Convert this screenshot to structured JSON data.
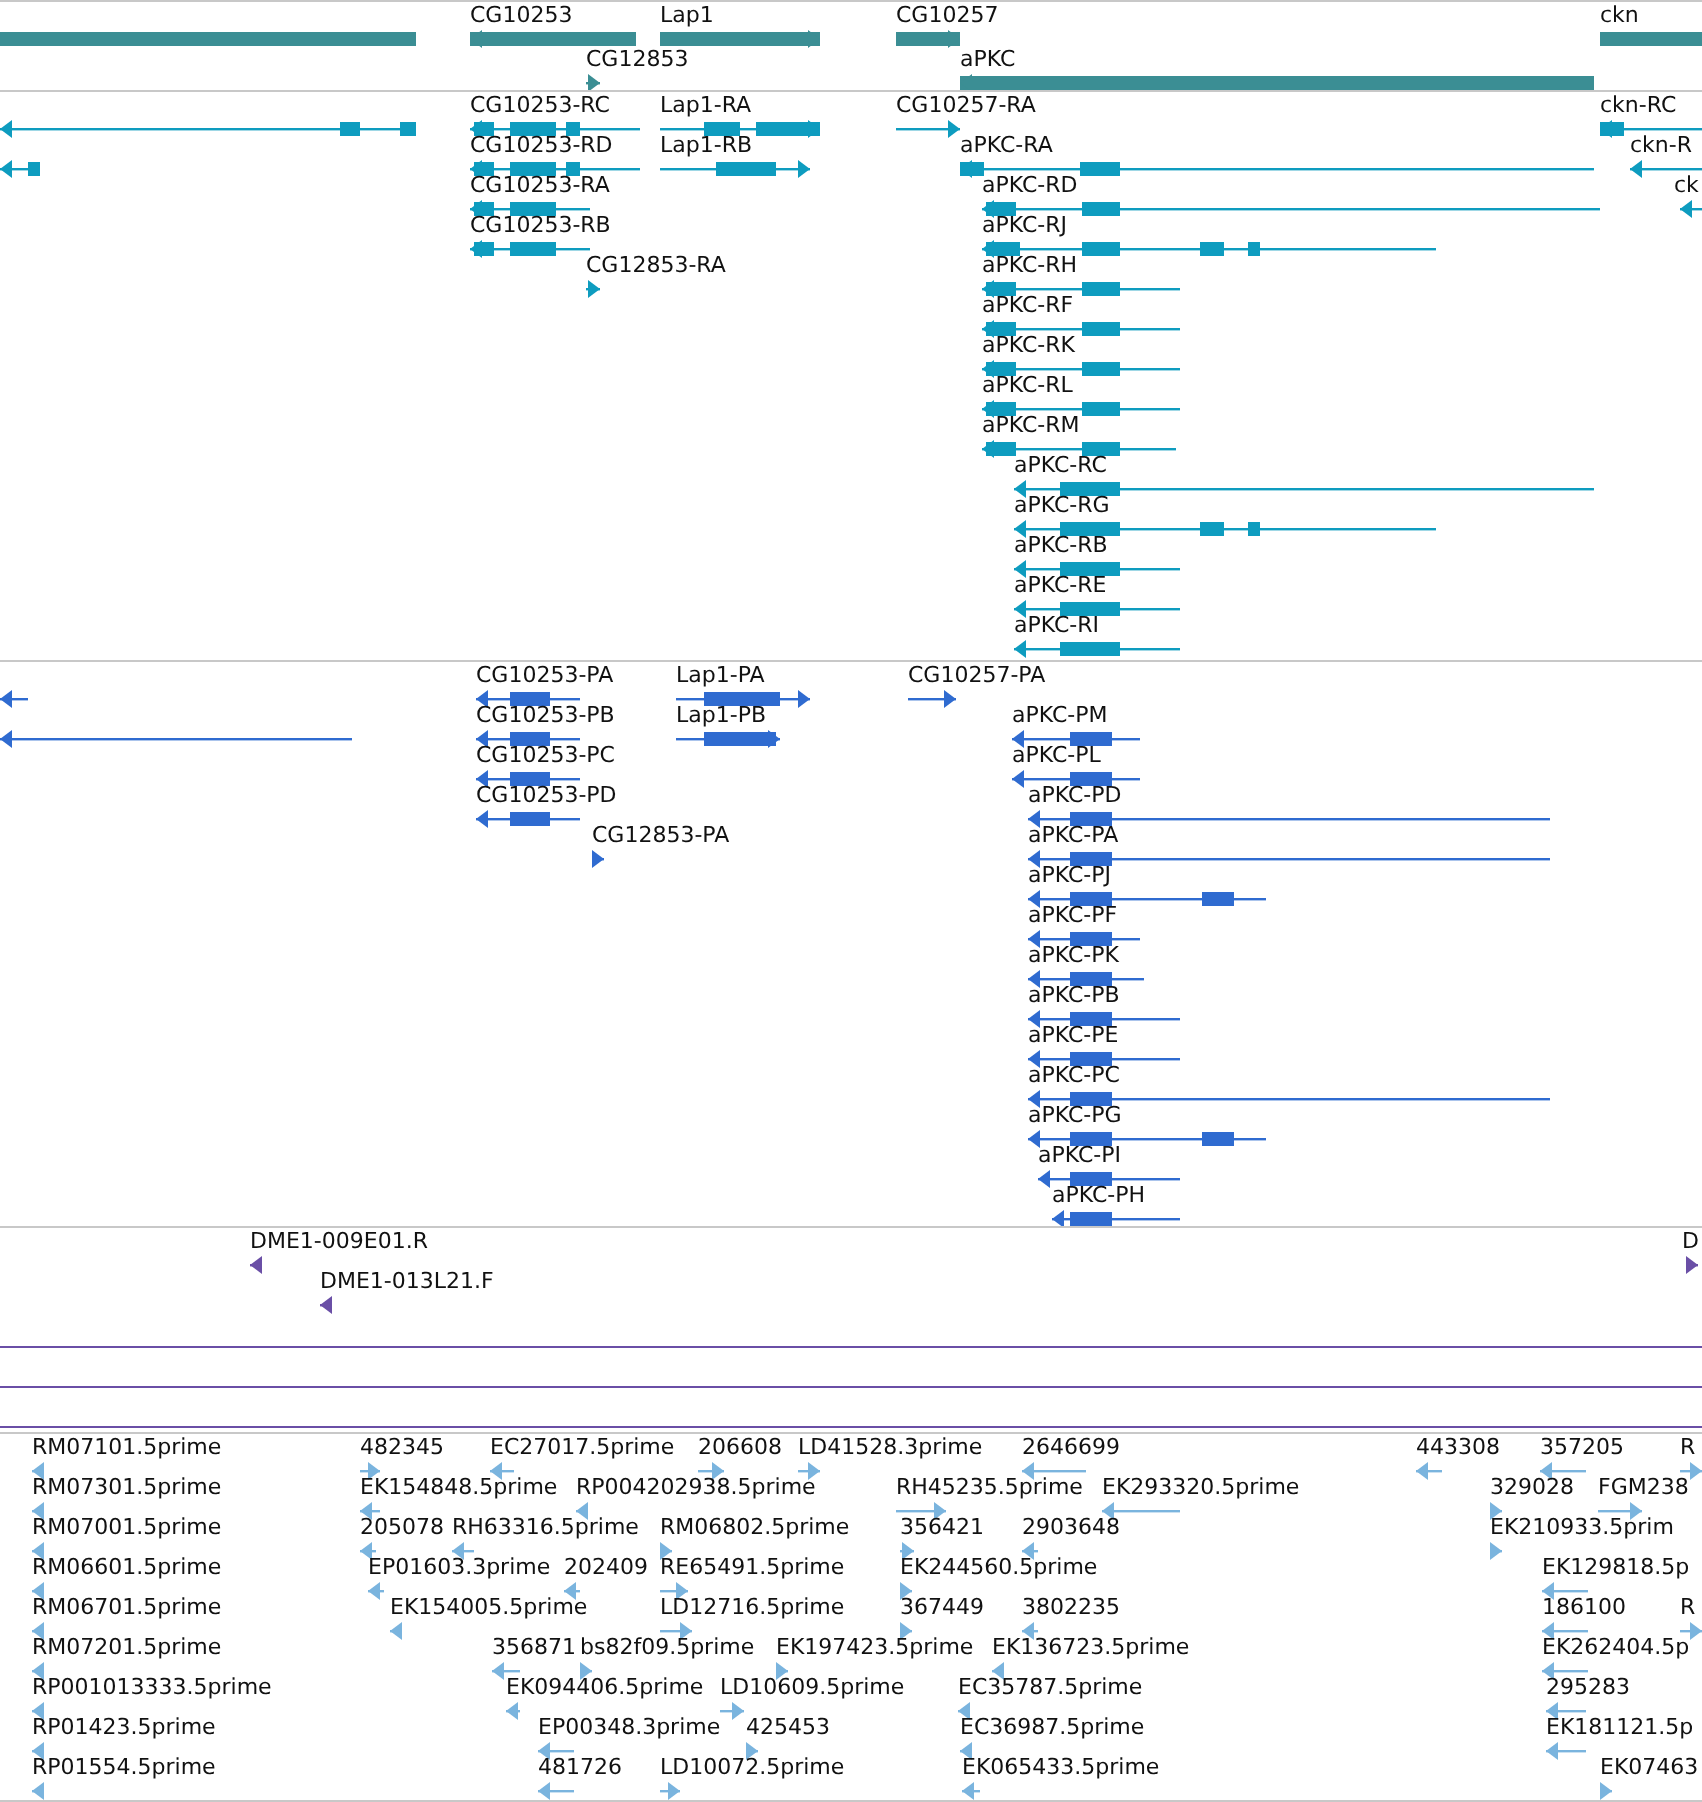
{
  "tracks": [
    {
      "kind": "genes",
      "features": [
        {
          "reverse": true
        },
        {
          "label": "CG10253",
          "reverse": true
        },
        {
          "label": "Lap1",
          "reverse": false
        },
        {
          "label": "CG10257",
          "reverse": false
        },
        {
          "label": "ckn"
        },
        {
          "label": "CG12853",
          "reverse": false
        },
        {
          "label": "aPKC",
          "reverse": true
        }
      ]
    },
    {
      "kind": "transcripts",
      "features": [
        {
          "reverse": true
        },
        {
          "label": "CG10253-RC",
          "reverse": true
        },
        {
          "label": "Lap1-RA",
          "reverse": false
        },
        {
          "label": "CG10257-RA",
          "reverse": false
        },
        {
          "label": "ckn-RC",
          "reverse": true
        },
        {
          "reverse": true
        },
        {
          "label": "CG10253-RD",
          "reverse": true
        },
        {
          "label": "Lap1-RB",
          "reverse": false
        },
        {
          "label": "aPKC-RA",
          "reverse": true
        },
        {
          "label": "ckn-R",
          "reverse": true
        },
        {
          "label": "CG10253-RA",
          "reverse": true
        },
        {
          "label": "aPKC-RD",
          "reverse": true
        },
        {
          "label": "ck",
          "reverse": true
        },
        {
          "label": "CG10253-RB",
          "reverse": true
        },
        {
          "label": "aPKC-RJ",
          "reverse": true
        },
        {
          "label": "CG12853-RA",
          "reverse": false
        },
        {
          "label": "aPKC-RH",
          "reverse": true
        },
        {
          "label": "aPKC-RF",
          "reverse": true
        },
        {
          "label": "aPKC-RK",
          "reverse": true
        },
        {
          "label": "aPKC-RL",
          "reverse": true
        },
        {
          "label": "aPKC-RM",
          "reverse": true
        },
        {
          "label": "aPKC-RC",
          "reverse": true
        },
        {
          "label": "aPKC-RG",
          "reverse": true
        },
        {
          "label": "aPKC-RB",
          "reverse": true
        },
        {
          "label": "aPKC-RE",
          "reverse": true
        },
        {
          "label": "aPKC-RI",
          "reverse": true
        }
      ]
    },
    {
      "kind": "proteins",
      "features": [
        {
          "reverse": true
        },
        {
          "label": "CG10253-PA",
          "reverse": true
        },
        {
          "label": "Lap1-PA",
          "reverse": false
        },
        {
          "label": "CG10257-PA",
          "reverse": false
        },
        {
          "reverse": true
        },
        {
          "label": "CG10253-PB",
          "reverse": true
        },
        {
          "label": "Lap1-PB",
          "reverse": false
        },
        {
          "label": "aPKC-PM",
          "reverse": true
        },
        {
          "label": "CG10253-PC",
          "reverse": true
        },
        {
          "label": "aPKC-PL",
          "reverse": true
        },
        {
          "label": "CG10253-PD",
          "reverse": true
        },
        {
          "label": "aPKC-PD",
          "reverse": true
        },
        {
          "label": "CG12853-PA",
          "reverse": false
        },
        {
          "label": "aPKC-PA",
          "reverse": true
        },
        {
          "label": "aPKC-PJ",
          "reverse": true
        },
        {
          "label": "aPKC-PF",
          "reverse": true
        },
        {
          "label": "aPKC-PK",
          "reverse": true
        },
        {
          "label": "aPKC-PB",
          "reverse": true
        },
        {
          "label": "aPKC-PE",
          "reverse": true
        },
        {
          "label": "aPKC-PC",
          "reverse": true
        },
        {
          "label": "aPKC-PG",
          "reverse": true
        },
        {
          "label": "aPKC-PI",
          "reverse": true
        },
        {
          "label": "aPKC-PH",
          "reverse": true
        }
      ]
    },
    {
      "kind": "clones",
      "features": [
        {
          "label": "DME1-009E01.R",
          "reverse": true
        },
        {
          "label": "D",
          "reverse": false
        },
        {
          "label": "DME1-013L21.F",
          "reverse": true
        }
      ]
    },
    {
      "kind": "ests",
      "features": [
        {
          "label": "RM07101.5prime",
          "reverse": true
        },
        {
          "label": "482345",
          "reverse": false
        },
        {
          "label": "EC27017.5prime",
          "reverse": true
        },
        {
          "label": "206608",
          "reverse": false
        },
        {
          "label": "LD41528.3prime",
          "reverse": false
        },
        {
          "label": "2646699",
          "reverse": true
        },
        {
          "label": "443308",
          "reverse": true
        },
        {
          "label": "357205",
          "reverse": true
        },
        {
          "label": "R",
          "reverse": false
        },
        {
          "label": "RM07301.5prime",
          "reverse": true
        },
        {
          "label": "EK154848.5prime",
          "reverse": true
        },
        {
          "label": "RP004202938.5prime",
          "reverse": true
        },
        {
          "label": "RH45235.5prime",
          "reverse": false
        },
        {
          "label": "EK293320.5prime",
          "reverse": true
        },
        {
          "label": "329028",
          "reverse": false
        },
        {
          "label": "FGM238",
          "reverse": false
        },
        {
          "label": "RM07001.5prime",
          "reverse": true
        },
        {
          "label": "205078",
          "reverse": true
        },
        {
          "label": "RH63316.5prime",
          "reverse": true
        },
        {
          "label": "RM06802.5prime",
          "reverse": false
        },
        {
          "label": "356421",
          "reverse": false
        },
        {
          "label": "2903648",
          "reverse": true
        },
        {
          "label": "EK210933.5prim",
          "reverse": false
        },
        {
          "label": "RM06601.5prime",
          "reverse": true
        },
        {
          "label": "EP01603.3prime",
          "reverse": true
        },
        {
          "label": "202409",
          "reverse": true
        },
        {
          "label": "RE65491.5prime",
          "reverse": false
        },
        {
          "label": "EK244560.5prime",
          "reverse": false
        },
        {
          "label": "EK129818.5p",
          "reverse": true
        },
        {
          "label": "RM06701.5prime",
          "reverse": true
        },
        {
          "label": "EK154005.5prime",
          "reverse": true
        },
        {
          "label": "LD12716.5prime",
          "reverse": false
        },
        {
          "label": "367449",
          "reverse": false
        },
        {
          "label": "3802235",
          "reverse": true
        },
        {
          "label": "186100",
          "reverse": true
        },
        {
          "label": "R",
          "reverse": false
        },
        {
          "label": "RM07201.5prime",
          "reverse": true
        },
        {
          "label": "356871",
          "reverse": true
        },
        {
          "label": "bs82f09.5prime",
          "reverse": false
        },
        {
          "label": "EK197423.5prime",
          "reverse": false
        },
        {
          "label": "EK136723.5prime",
          "reverse": true
        },
        {
          "label": "EK262404.5p",
          "reverse": true
        },
        {
          "label": "RP001013333.5prime",
          "reverse": true
        },
        {
          "label": "EK094406.5prime",
          "reverse": true
        },
        {
          "label": "LD10609.5prime",
          "reverse": false
        },
        {
          "label": "EC35787.5prime",
          "reverse": true
        },
        {
          "label": "295283",
          "reverse": true
        },
        {
          "label": "RP01423.5prime",
          "reverse": true
        },
        {
          "label": "EP00348.3prime",
          "reverse": true
        },
        {
          "label": "425453",
          "reverse": false
        },
        {
          "label": "EC36987.5prime",
          "reverse": true
        },
        {
          "label": "EK181121.5p",
          "reverse": true
        },
        {
          "label": "RP01554.5prime",
          "reverse": true
        },
        {
          "label": "481726",
          "reverse": true
        },
        {
          "label": "LD10072.5prime",
          "reverse": false
        },
        {
          "label": "EK065433.5prime",
          "reverse": true
        },
        {
          "label": "EK07463",
          "reverse": false
        }
      ]
    }
  ]
}
